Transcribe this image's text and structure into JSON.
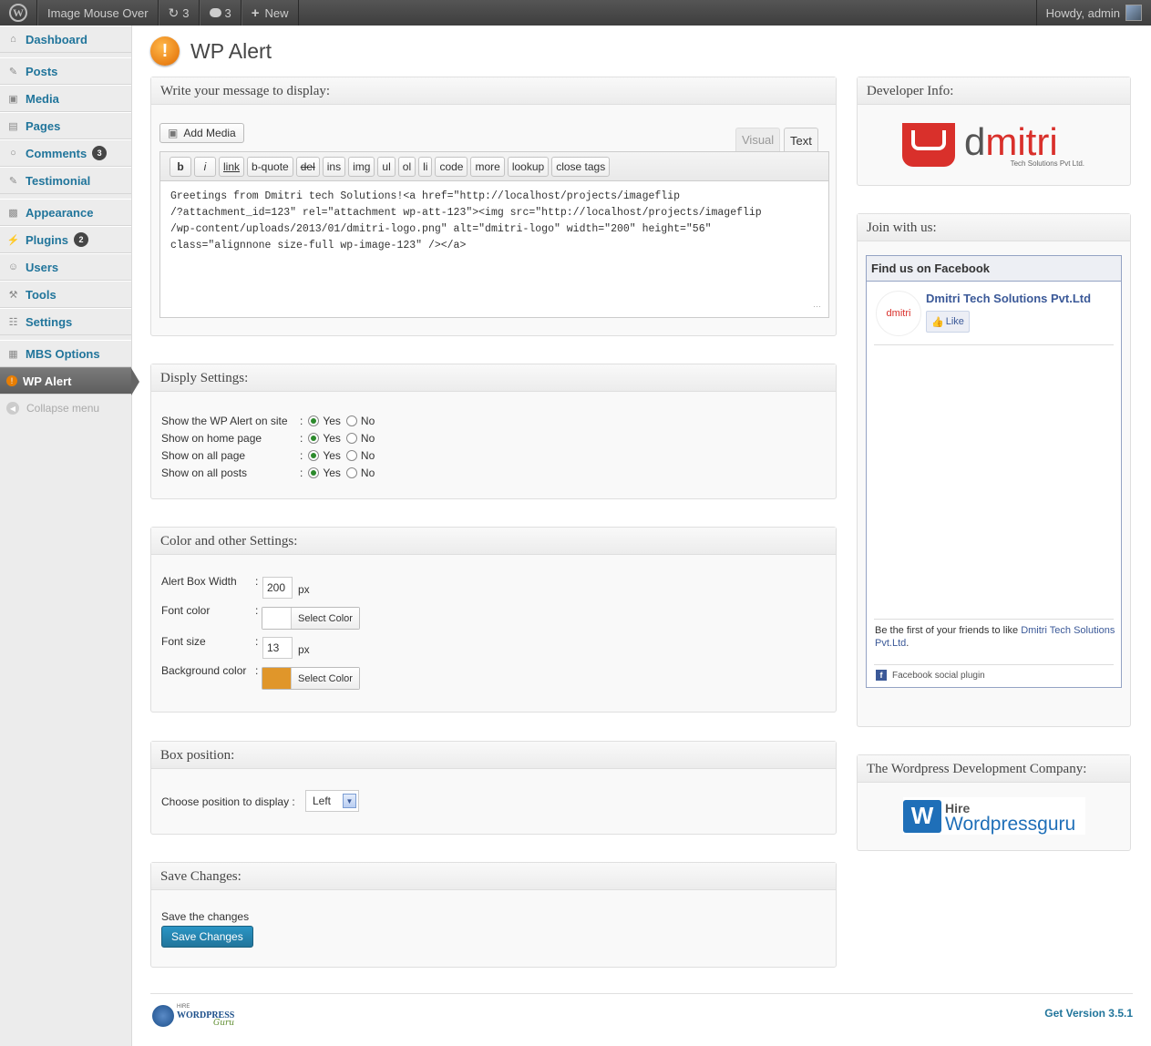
{
  "adminbar": {
    "site_name": "Image Mouse Over",
    "updates_count": "3",
    "comments_count": "3",
    "new_label": "New",
    "howdy": "Howdy, admin"
  },
  "menu": {
    "dashboard": "Dashboard",
    "posts": "Posts",
    "media": "Media",
    "pages": "Pages",
    "comments": "Comments",
    "comments_badge": "3",
    "testimonial": "Testimonial",
    "appearance": "Appearance",
    "plugins": "Plugins",
    "plugins_badge": "2",
    "users": "Users",
    "tools": "Tools",
    "settings": "Settings",
    "mbs": "MBS Options",
    "wpalert": "WP Alert",
    "collapse": "Collapse menu"
  },
  "page": {
    "title": "WP Alert"
  },
  "message_box": {
    "title": "Write your message to display:",
    "add_media": "Add Media",
    "tab_visual": "Visual",
    "tab_text": "Text",
    "quicktags": [
      "b",
      "i",
      "link",
      "b-quote",
      "del",
      "ins",
      "img",
      "ul",
      "ol",
      "li",
      "code",
      "more",
      "lookup",
      "close tags"
    ],
    "content": "Greetings from Dmitri tech Solutions!<a href=\"http://localhost/projects/imageflip\n/?attachment_id=123\" rel=\"attachment wp-att-123\"><img src=\"http://localhost/projects/imageflip\n/wp-content/uploads/2013/01/dmitri-logo.png\" alt=\"dmitri-logo\" width=\"200\" height=\"56\"\nclass=\"alignnone size-full wp-image-123\" /></a>"
  },
  "display_settings": {
    "title": "Disply Settings:",
    "yes": "Yes",
    "no": "No",
    "rows": [
      {
        "label": "Show the WP Alert on site",
        "value": "Yes"
      },
      {
        "label": "Show on home page",
        "value": "Yes"
      },
      {
        "label": "Show on all page",
        "value": "Yes"
      },
      {
        "label": "Show on all posts",
        "value": "Yes"
      }
    ]
  },
  "color_settings": {
    "title": "Color and other Settings:",
    "width_label": "Alert Box Width",
    "width_value": "200",
    "px": "px",
    "font_color_label": "Font color",
    "font_color": "#ffffff",
    "select_color": "Select Color",
    "font_size_label": "Font size",
    "font_size_value": "13",
    "bg_color_label": "Background color",
    "bg_color": "#e0962a"
  },
  "position": {
    "title": "Box position:",
    "label": "Choose position to display :",
    "value": "Left"
  },
  "save": {
    "title": "Save Changes:",
    "text": "Save the changes",
    "button": "Save Changes"
  },
  "developer": {
    "title": "Developer Info:",
    "logo_d": "d",
    "logo_mitri": "mitri",
    "logo_sub": "Tech Solutions Pvt Ltd."
  },
  "join": {
    "title": "Join with us:",
    "fb_header": "Find us on Facebook",
    "page_name": "Dmitri Tech Solutions Pvt.Ltd",
    "thumb_text": "dmitri",
    "like": "Like",
    "first_friends_prefix": "Be the first of your friends to like",
    "first_friends_link": "Dmitri Tech Solutions Pvt.Ltd",
    "social_plugin": "Facebook social plugin"
  },
  "company": {
    "title": "The Wordpress Development Company:",
    "hire": "Hire",
    "brand": "Wordpressguru"
  },
  "footer": {
    "logo_hire": "HIRE",
    "logo_text": "WORDPRESS",
    "logo_script": "Guru",
    "version": "Get Version 3.5.1"
  },
  "colors": {
    "link": "#21759b",
    "accent_orange": "#e87e04",
    "dmitri_red": "#d9302b"
  }
}
